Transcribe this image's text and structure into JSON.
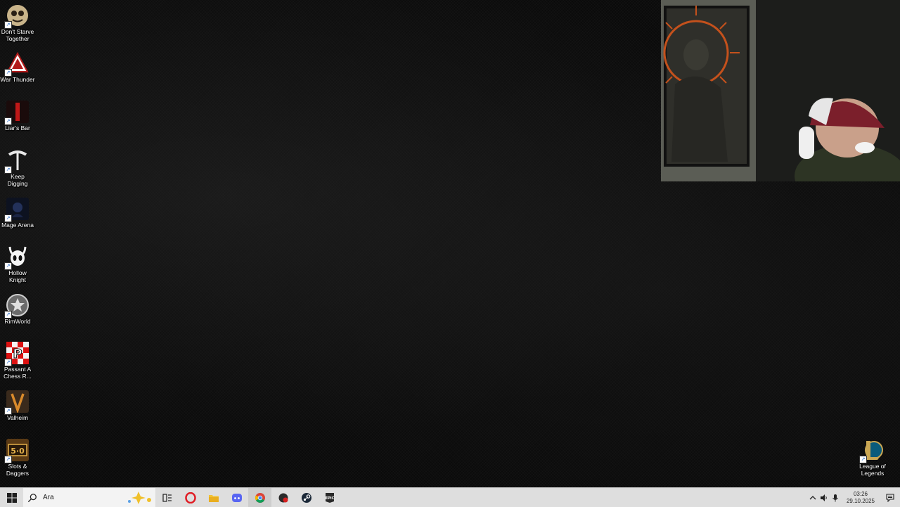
{
  "desktop": {
    "icons": [
      {
        "label": "Don't Starve Together",
        "icon": "dont-starve-together-icon"
      },
      {
        "label": "War Thunder",
        "icon": "war-thunder-icon"
      },
      {
        "label": "Liar's Bar",
        "icon": "liars-bar-icon"
      },
      {
        "label": "Keep Digging",
        "icon": "pickaxe-icon"
      },
      {
        "label": "Mage Arena",
        "icon": "mage-arena-icon"
      },
      {
        "label": "Hollow Knight",
        "icon": "hollow-knight-icon"
      },
      {
        "label": "RimWorld",
        "icon": "rimworld-icon"
      },
      {
        "label": "Passant A Chess R...",
        "icon": "passant-chess-icon"
      },
      {
        "label": "Valheim",
        "icon": "valheim-icon"
      },
      {
        "label": "Slots & Daggers",
        "icon": "slots-daggers-icon"
      }
    ],
    "right_icon": {
      "label": "League of Legends",
      "icon": "league-of-legends-icon"
    }
  },
  "taskbar": {
    "search_placeholder": "Ara",
    "pinned": [
      "task-view-icon",
      "opera-icon",
      "file-explorer-icon",
      "discord-icon",
      "chrome-icon",
      "game-app-icon",
      "steam-icon",
      "epic-games-icon"
    ],
    "clock_time": "03:26",
    "clock_date": "29.10.2025"
  }
}
